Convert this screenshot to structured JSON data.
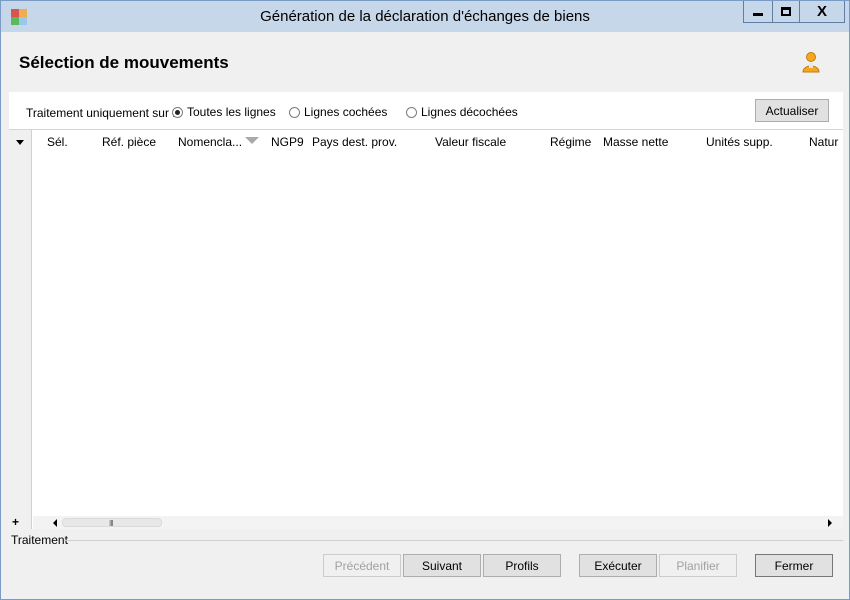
{
  "window": {
    "title": "Génération de la déclaration d'échanges de biens",
    "minimize_glyph": "",
    "close_glyph": "X"
  },
  "header": {
    "title": "Sélection de mouvements",
    "user_icon": "user-icon"
  },
  "filter": {
    "label": "Traitement uniquement sur :",
    "options": [
      {
        "label": "Toutes les lignes",
        "checked": true
      },
      {
        "label": "Lignes cochées",
        "checked": false
      },
      {
        "label": "Lignes décochées",
        "checked": false
      }
    ],
    "refresh_label": "Actualiser"
  },
  "grid": {
    "columns": [
      "Sél.",
      "Réf. pièce",
      "Nomencla...",
      "NGP9",
      "Pays dest. prov.",
      "Valeur fiscale",
      "Régime",
      "Masse nette",
      "Unités supp.",
      "Natur"
    ],
    "rows": [],
    "add_glyph": "+",
    "scroll_grip": "III"
  },
  "section": {
    "label": "Traitement"
  },
  "buttons": {
    "previous": "Précédent",
    "next": "Suivant",
    "profiles": "Profils",
    "execute": "Exécuter",
    "schedule": "Planifier",
    "close": "Fermer"
  },
  "colors": {
    "titlebar": "#c7d7ea",
    "panel": "#f0f0f0",
    "grid_bg": "#ffffff",
    "user_icon": "#f5a623"
  }
}
